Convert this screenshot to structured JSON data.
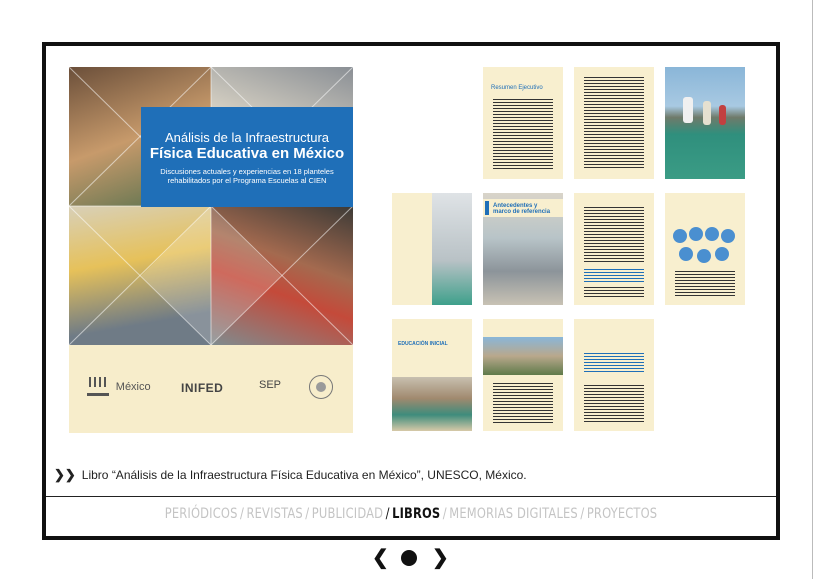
{
  "cover": {
    "title_line1": "Análisis de la Infraestructura",
    "title_line2": "Física Educativa en México",
    "subtitle": "Discusiones actuales y experiencias en 18 planteles rehabilitados por el Programa Escuelas al CIEN",
    "logos": {
      "unesco": "México",
      "inifed": "INIFED",
      "sep": "SEP"
    }
  },
  "thumbnails": {
    "resumen": "Resumen Ejecutivo",
    "antecedentes": "Antecedentes y marco de referencia",
    "educacion": "EDUCACIÓN INICIAL"
  },
  "caption": "Libro “Análisis de la Infraestructura Física Educativa en México”, UNESCO, México.",
  "nav": {
    "items": [
      "PERIÓDICOS",
      "REVISTAS",
      "PUBLICIDAD",
      "LIBROS",
      "MEMORIAS DIGITALES",
      "PROYECTOS"
    ],
    "separator": "/",
    "active": "LIBROS"
  },
  "pager": {
    "prev": "❮",
    "next": "❯"
  },
  "colors": {
    "accent_blue": "#1f6fb8",
    "page_cream": "#f8efcf",
    "frame": "#111111",
    "nav_inactive": "#c4c4c4"
  }
}
